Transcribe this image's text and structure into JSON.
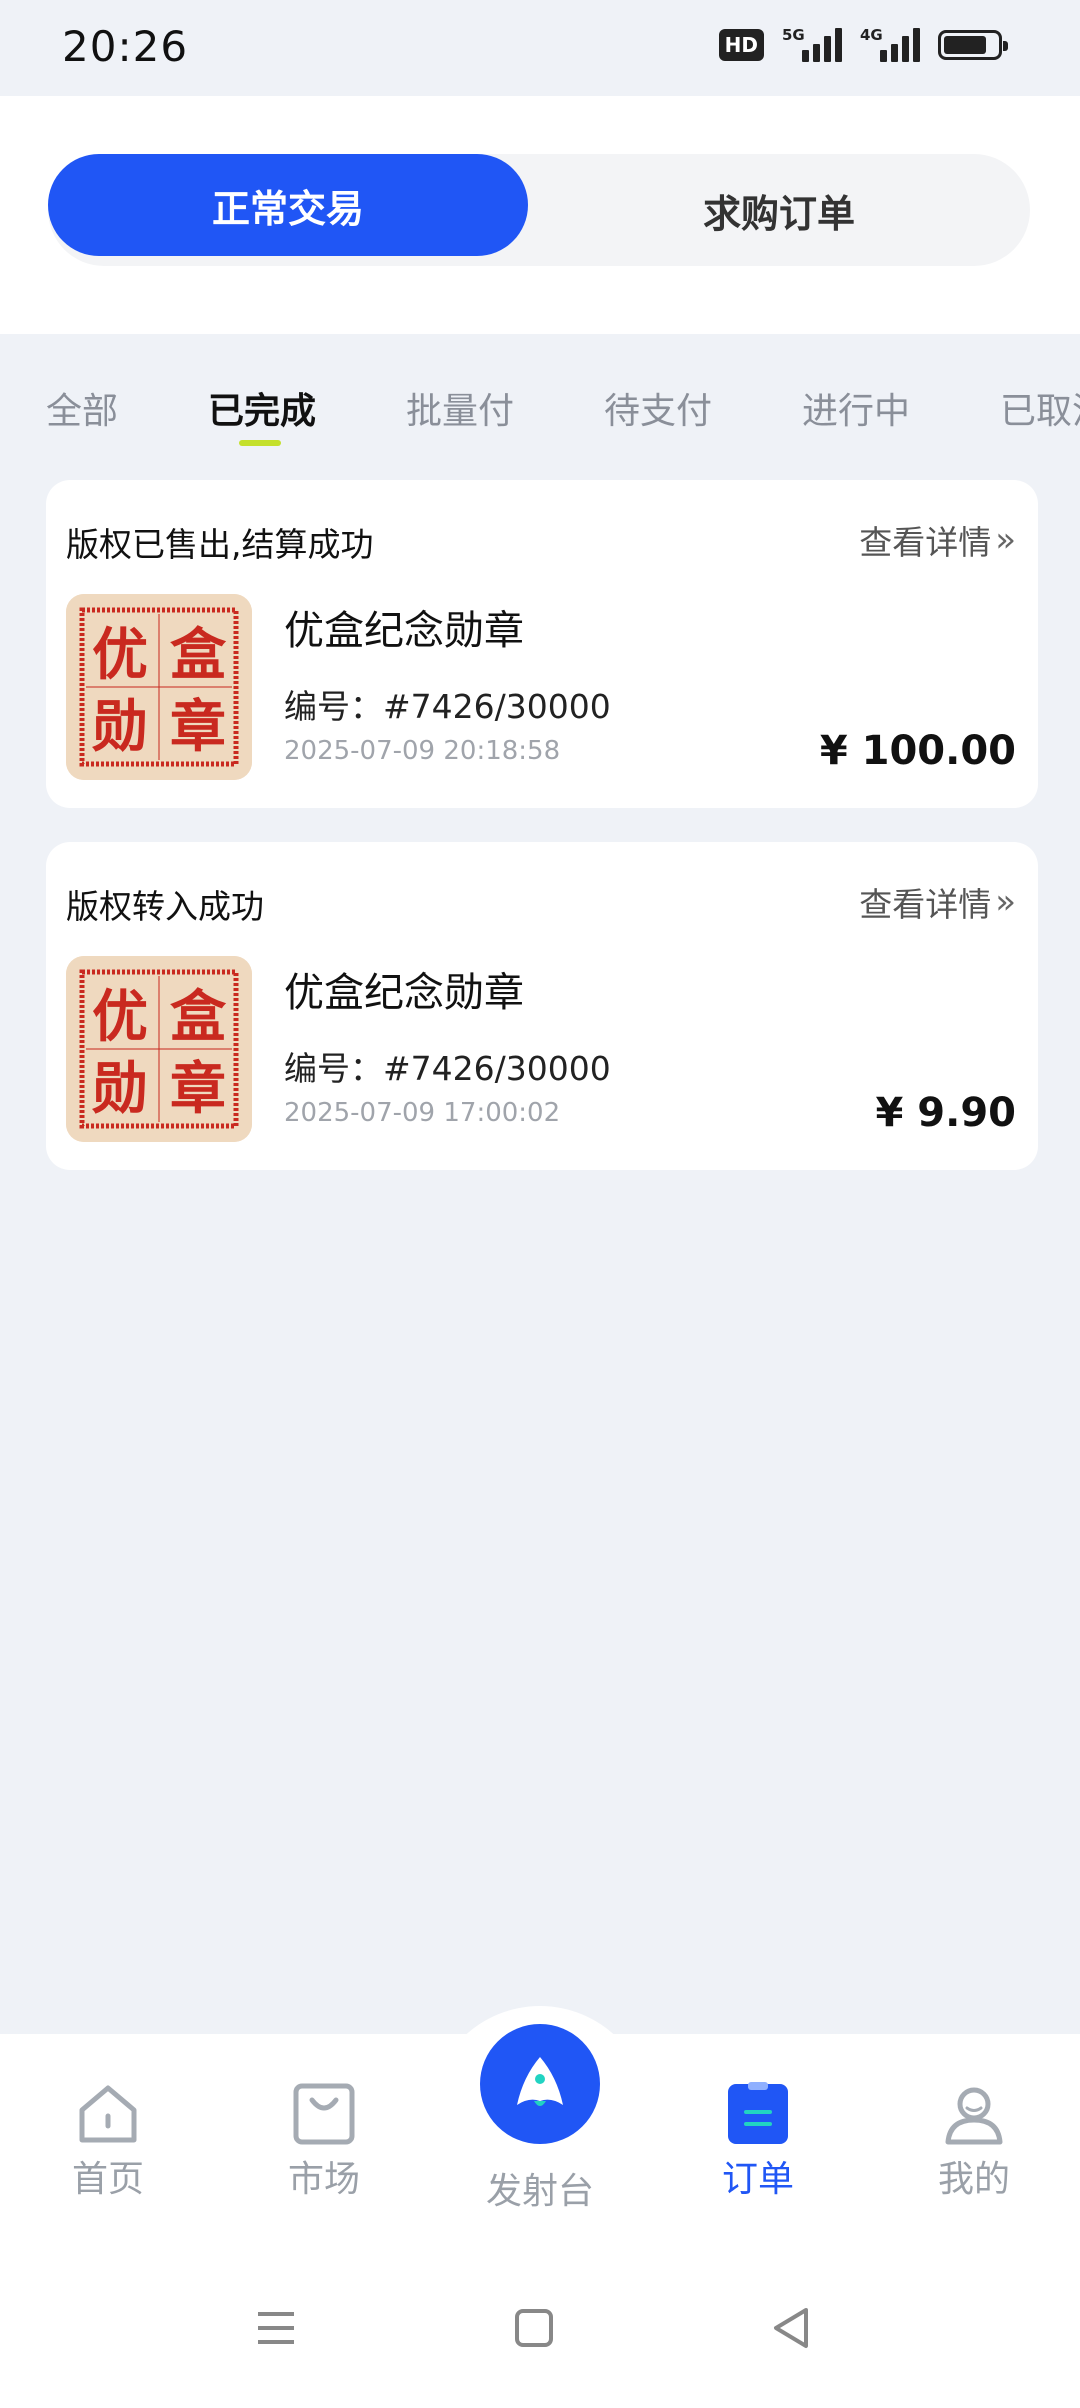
{
  "status_bar": {
    "time": "20:26",
    "hd_badge": "HD",
    "network_1": "5G",
    "network_2": "4G",
    "battery_level": 0.8
  },
  "segment": {
    "items": [
      {
        "label": "正常交易",
        "active": true
      },
      {
        "label": "求购订单",
        "active": false
      }
    ]
  },
  "tabs": [
    {
      "label": "全部"
    },
    {
      "label": "已完成",
      "active": true
    },
    {
      "label": "批量付"
    },
    {
      "label": "待支付"
    },
    {
      "label": "进行中"
    },
    {
      "label": "已取消"
    }
  ],
  "orders": [
    {
      "status": "版权已售出,结算成功",
      "detail_label": "查看详情",
      "detail_chevron": "»",
      "thumb_chars": [
        "优",
        "盒",
        "勋",
        "章"
      ],
      "title": "优盒纪念勋章",
      "serial": "编号：#7426/30000",
      "time": "2025-07-09 20:18:58",
      "price": "¥ 100.00"
    },
    {
      "status": "版权转入成功",
      "detail_label": "查看详情",
      "detail_chevron": "»",
      "thumb_chars": [
        "优",
        "盒",
        "勋",
        "章"
      ],
      "title": "优盒纪念勋章",
      "serial": "编号：#7426/30000",
      "time": "2025-07-09 17:00:02",
      "price": "¥ 9.90"
    }
  ],
  "bottom_nav": {
    "items": [
      {
        "label": "首页",
        "icon": "home-icon"
      },
      {
        "label": "市场",
        "icon": "market-bag-icon"
      },
      {
        "label": "发射台",
        "icon": "rocket-icon"
      },
      {
        "label": "订单",
        "icon": "order-clipboard-icon",
        "active": true
      },
      {
        "label": "我的",
        "icon": "profile-icon"
      }
    ]
  },
  "system_nav": {
    "icons": [
      "menu-icon",
      "home-square-icon",
      "back-icon"
    ]
  },
  "colors": {
    "accent": "#2056f5",
    "tab_underline": "#c4e02c",
    "background": "#eff2f7",
    "seal_red": "#c9291f",
    "seal_bg": "#efd9bf"
  }
}
